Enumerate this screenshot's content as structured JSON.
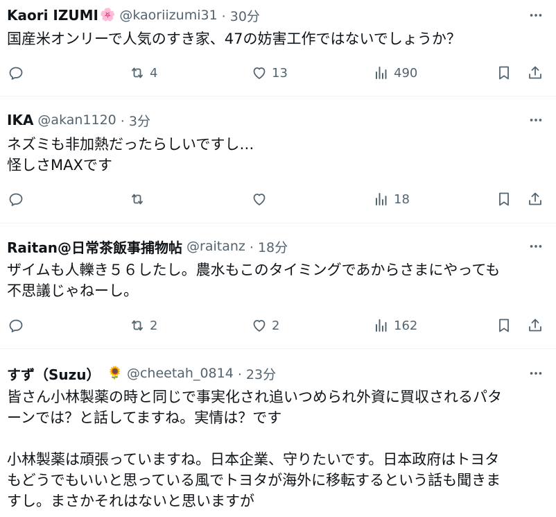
{
  "tweets": [
    {
      "name": "Kaori IZUMI",
      "emoji": "🌸",
      "handle": "@kaoriizumi31",
      "time": "· 30分",
      "text": "国産米オンリーで人気のすき家、47の妨害工作ではないでしょうか？",
      "replies": "",
      "retweets": "4",
      "likes": "13",
      "views": "490"
    },
    {
      "name": "IKA",
      "emoji": "",
      "handle": "@akan1120",
      "time": "· 3分",
      "text": "ネズミも非加熱だったらしいですし…\n怪しさMAXです",
      "replies": "",
      "retweets": "",
      "likes": "",
      "views": "18"
    },
    {
      "name": "Raitan@日常茶飯事捕物帖",
      "emoji": "",
      "handle": "@raitanz",
      "time": "· 18分",
      "text": "ザイムも人轢き５６したし。農水もこのタイミングであからさまにやっても\n不思議じゃねーし。",
      "replies": "",
      "retweets": "2",
      "likes": "2",
      "views": "162"
    },
    {
      "name": "すず（Suzu）",
      "emoji": "🌻",
      "handle": "@cheetah_0814",
      "time": "· 23分",
      "text": "皆さん小林製薬の時と同じで事実化され追いつめられ外資に買収されるパタ\nーンでは？と話してますね。実情は？です\n\n小林製薬は頑張っていますね。日本企業、守りたいです。日本政府はトヨタ\nもどうでもいいと思っている風でトヨタが海外に移転するという話も聞きま\nすし。まさかそれはないと思いますが",
      "replies": "",
      "retweets": "",
      "likes": "",
      "views": ""
    }
  ],
  "icons": {
    "more": "more-icon",
    "reply": "reply-icon",
    "retweet": "retweet-icon",
    "like": "heart-icon",
    "views": "views-icon",
    "bookmark": "bookmark-icon",
    "share": "share-icon"
  },
  "colors": {
    "text": "#0f1419",
    "secondary": "#536471",
    "divider": "#eff3f4"
  }
}
